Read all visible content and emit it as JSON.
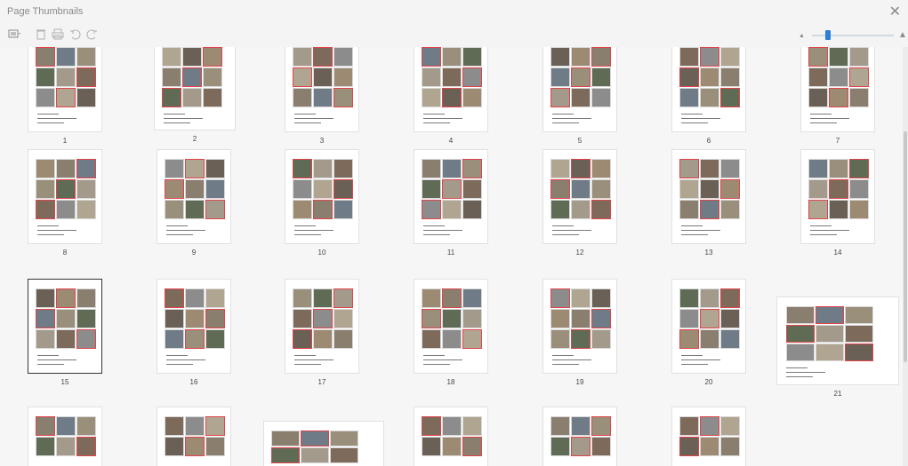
{
  "panel": {
    "title": "Page Thumbnails",
    "close_glyph": "✕"
  },
  "toolbar": {
    "icons": [
      "thumbnail-options-icon",
      "delete-page-icon",
      "print-page-icon",
      "rotate-left-icon",
      "rotate-right-icon"
    ],
    "zoom_slider": {
      "value": 0.18
    }
  },
  "pages": [
    {
      "label": "1",
      "selected": false
    },
    {
      "label": "2",
      "selected": false
    },
    {
      "label": "3",
      "selected": false
    },
    {
      "label": "4",
      "selected": false
    },
    {
      "label": "5",
      "selected": false
    },
    {
      "label": "6",
      "selected": false
    },
    {
      "label": "7",
      "selected": false
    },
    {
      "label": "8",
      "selected": false
    },
    {
      "label": "9",
      "selected": false
    },
    {
      "label": "10",
      "selected": false
    },
    {
      "label": "11",
      "selected": false
    },
    {
      "label": "12",
      "selected": false
    },
    {
      "label": "13",
      "selected": false
    },
    {
      "label": "14",
      "selected": false
    },
    {
      "label": "15",
      "selected": true
    },
    {
      "label": "16",
      "selected": false
    },
    {
      "label": "17",
      "selected": false
    },
    {
      "label": "18",
      "selected": false
    },
    {
      "label": "19",
      "selected": false
    },
    {
      "label": "20",
      "selected": false
    },
    {
      "label": "21",
      "selected": false
    }
  ],
  "colors": {
    "accent": "#2e7dd7",
    "photo_border": "#e0444a",
    "photo_tones": [
      "#8a7f6f",
      "#6f7b86",
      "#9a8f7b",
      "#5f6b55",
      "#a39a8c",
      "#7d6a5a",
      "#8c8c8c",
      "#b0a590",
      "#6b6055",
      "#9c8a73"
    ]
  }
}
